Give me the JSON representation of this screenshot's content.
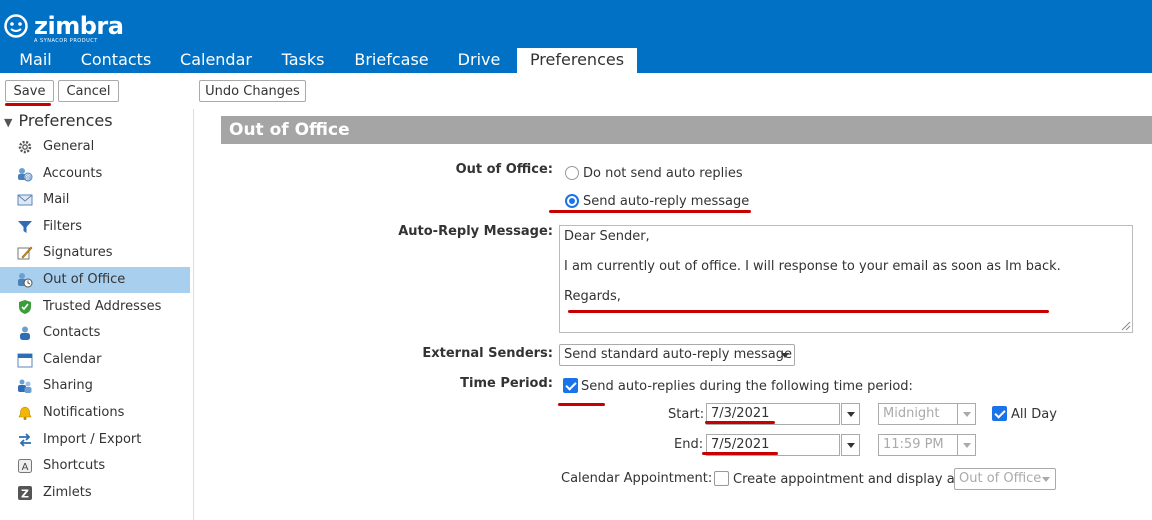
{
  "brand": {
    "name": "zimbra",
    "tagline": "A SYNACOR PRODUCT"
  },
  "tabs": [
    {
      "label": "Mail"
    },
    {
      "label": "Contacts"
    },
    {
      "label": "Calendar"
    },
    {
      "label": "Tasks"
    },
    {
      "label": "Briefcase"
    },
    {
      "label": "Drive"
    },
    {
      "label": "Preferences",
      "active": true
    }
  ],
  "toolbar": {
    "save": "Save",
    "cancel": "Cancel",
    "undo": "Undo Changes"
  },
  "sidebar": {
    "heading": "Preferences",
    "items": [
      {
        "label": "General",
        "icon": "gear-icon"
      },
      {
        "label": "Accounts",
        "icon": "accounts-icon"
      },
      {
        "label": "Mail",
        "icon": "mail-icon"
      },
      {
        "label": "Filters",
        "icon": "filter-icon"
      },
      {
        "label": "Signatures",
        "icon": "signature-icon"
      },
      {
        "label": "Out of Office",
        "icon": "out-of-office-icon",
        "selected": true
      },
      {
        "label": "Trusted Addresses",
        "icon": "shield-icon"
      },
      {
        "label": "Contacts",
        "icon": "contacts-icon"
      },
      {
        "label": "Calendar",
        "icon": "calendar-icon"
      },
      {
        "label": "Sharing",
        "icon": "sharing-icon"
      },
      {
        "label": "Notifications",
        "icon": "bell-icon"
      },
      {
        "label": "Import / Export",
        "icon": "import-export-icon"
      },
      {
        "label": "Shortcuts",
        "icon": "shortcuts-icon"
      },
      {
        "label": "Zimlets",
        "icon": "zimlets-icon"
      }
    ]
  },
  "section": {
    "title": "Out of Office"
  },
  "form": {
    "out_of_office_label": "Out of Office:",
    "radio_no_reply": "Do not send auto replies",
    "radio_send_reply": "Send auto-reply message",
    "auto_reply_label": "Auto-Reply Message:",
    "message_lines": [
      "Dear Sender,",
      "I am currently out of office. I will response to your email as soon as Im back.",
      "Regards,"
    ],
    "external_senders_label": "External Senders:",
    "external_senders_value": "Send standard auto-reply message",
    "time_period_label": "Time Period:",
    "time_period_check": "Send auto-replies during the following time period:",
    "start_label": "Start:",
    "start_date": "7/3/2021",
    "start_time": "Midnight",
    "all_day": "All Day",
    "end_label": "End:",
    "end_date": "7/5/2021",
    "end_time": "11:59 PM",
    "calendar_appt_label": "Calendar Appointment:",
    "calendar_appt_check": "Create appointment and display as:",
    "calendar_appt_value": "Out of Office"
  },
  "colors": {
    "brand_blue": "#0071c5",
    "selection": "#a8cfee",
    "annotation_red": "#c80000",
    "section_gray": "#a5a5a5",
    "accent_blue": "#1a73e8"
  }
}
